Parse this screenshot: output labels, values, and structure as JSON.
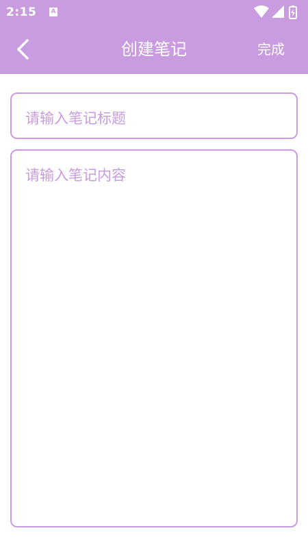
{
  "status_bar": {
    "time": "2:15",
    "notification_icon_letter": "A",
    "icons": [
      "wifi-icon",
      "signal-icon",
      "battery-charging-icon"
    ]
  },
  "app_bar": {
    "title": "创建笔记",
    "done_label": "完成",
    "back_icon": "chevron-left-icon"
  },
  "form": {
    "title_placeholder": "请输入笔记标题",
    "content_placeholder": "请输入笔记内容"
  },
  "colors": {
    "accent": "#c99ce0",
    "background": "#ffffff"
  }
}
